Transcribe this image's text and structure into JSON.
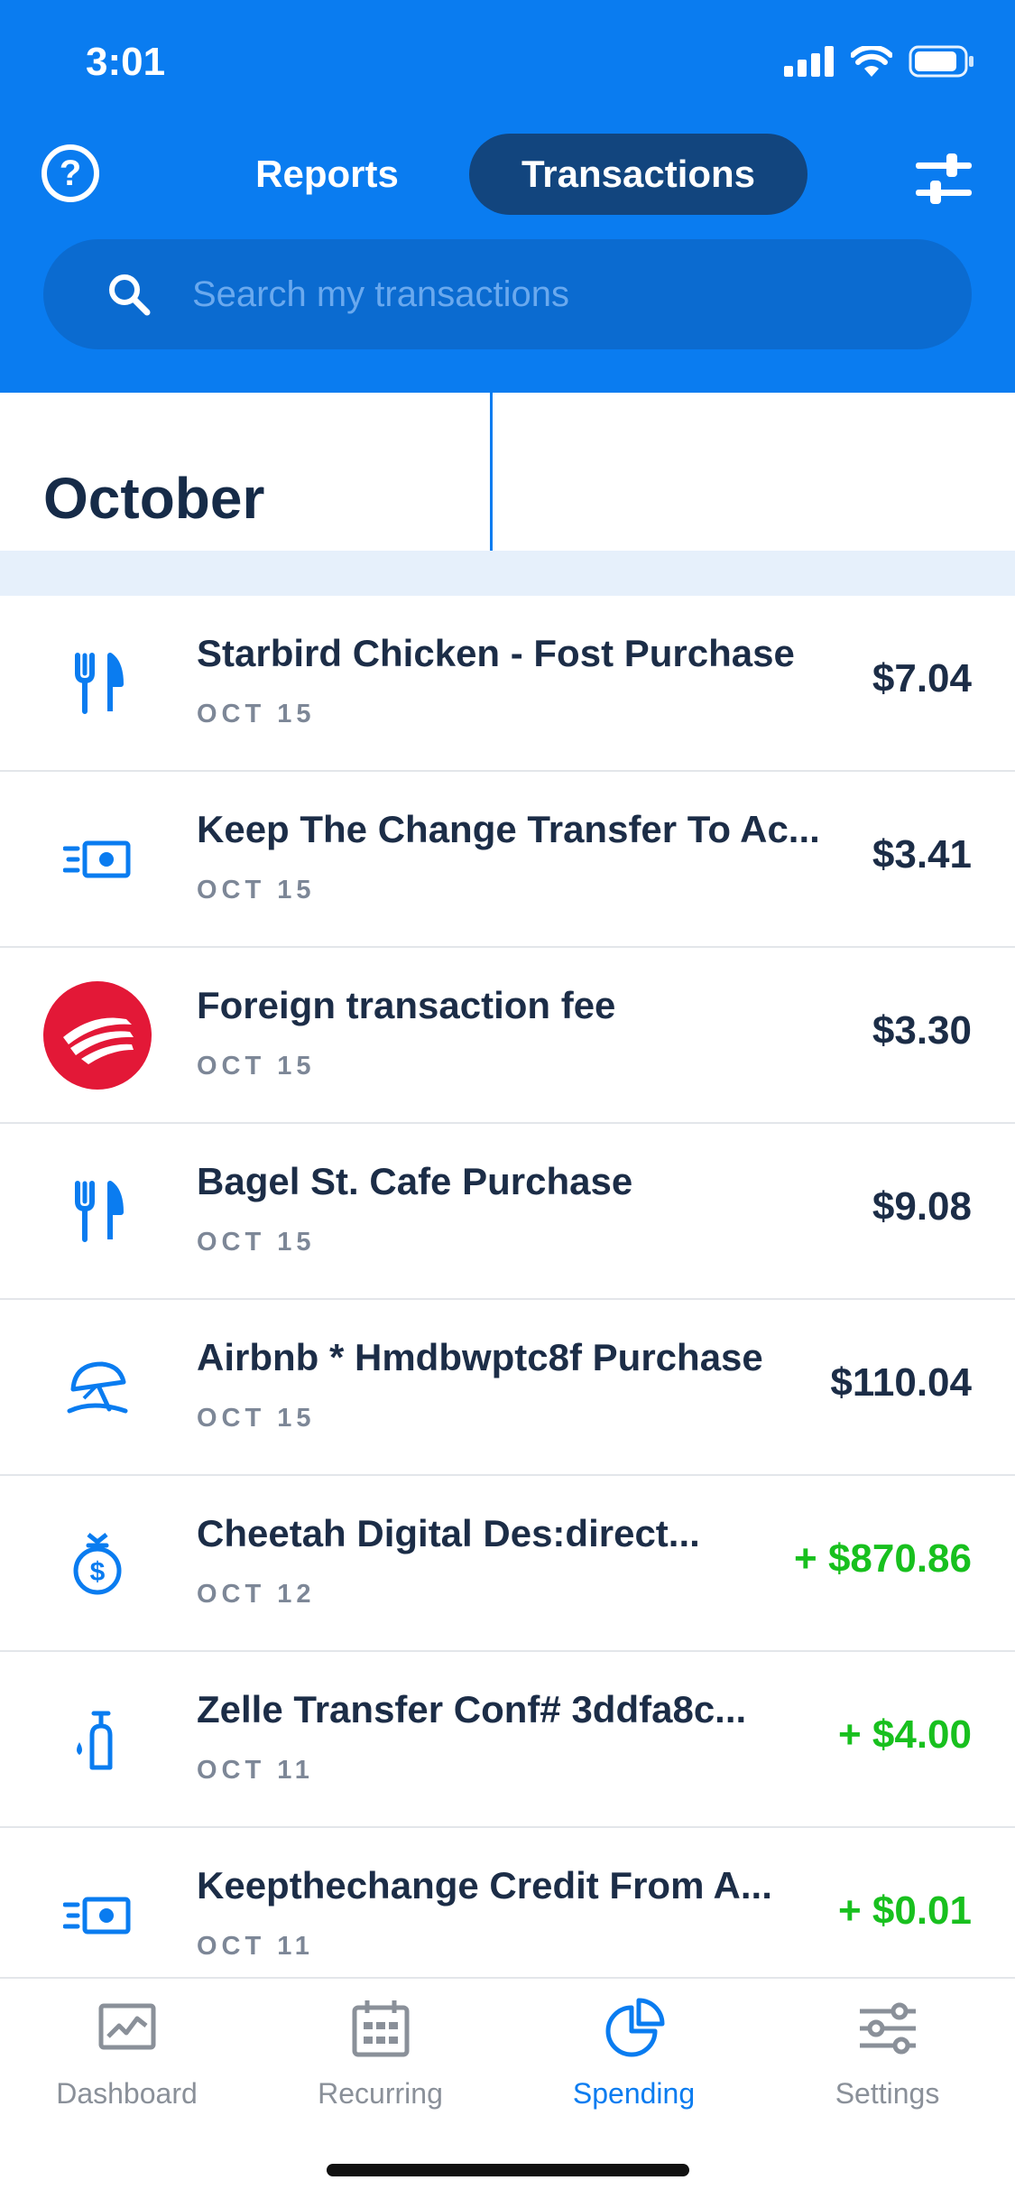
{
  "status_bar": {
    "time": "3:01"
  },
  "header": {
    "help_symbol": "?",
    "tabs": [
      {
        "label": "Reports",
        "active": false
      },
      {
        "label": "Transactions",
        "active": true
      }
    ],
    "search": {
      "placeholder": "Search my transactions",
      "value": ""
    }
  },
  "month": {
    "title": "October"
  },
  "transactions": [
    {
      "title": "Starbird Chicken - Fost Purchase",
      "date": "OCT 15",
      "amount": "$7.04",
      "icon": "fork-knife-icon",
      "credit": false
    },
    {
      "title": "Keep The Change Transfer To Ac...",
      "date": "OCT 15",
      "amount": "$3.41",
      "icon": "money-transfer-icon",
      "credit": false
    },
    {
      "title": "Foreign transaction fee",
      "date": "OCT 15",
      "amount": "$3.30",
      "icon": "bank-logo-icon",
      "credit": false
    },
    {
      "title": "Bagel St. Cafe Purchase",
      "date": "OCT 15",
      "amount": "$9.08",
      "icon": "fork-knife-icon",
      "credit": false
    },
    {
      "title": "Airbnb * Hmdbwptc8f Purchase",
      "date": "OCT 15",
      "amount": "$110.04",
      "icon": "beach-umbrella-icon",
      "credit": false
    },
    {
      "title": "Cheetah Digital Des:direct...",
      "date": "OCT 12",
      "amount": "+ $870.86",
      "icon": "money-bag-icon",
      "credit": true
    },
    {
      "title": "Zelle Transfer Conf# 3ddfa8c...",
      "date": "OCT 11",
      "amount": "+ $4.00",
      "icon": "soap-dispenser-icon",
      "credit": true
    },
    {
      "title": "Keepthechange Credit From A...",
      "date": "OCT 11",
      "amount": "+ $0.01",
      "icon": "money-transfer-icon",
      "credit": true
    }
  ],
  "tabbar": [
    {
      "label": "Dashboard",
      "icon": "chart-icon",
      "active": false
    },
    {
      "label": "Recurring",
      "icon": "calendar-icon",
      "active": false
    },
    {
      "label": "Spending",
      "icon": "pie-chart-icon",
      "active": true
    },
    {
      "label": "Settings",
      "icon": "sliders-icon",
      "active": false
    }
  ],
  "colors": {
    "brand": "#0a7cf0",
    "credit": "#18c01e",
    "text": "#1c2d47",
    "bank_red": "#e31837"
  }
}
